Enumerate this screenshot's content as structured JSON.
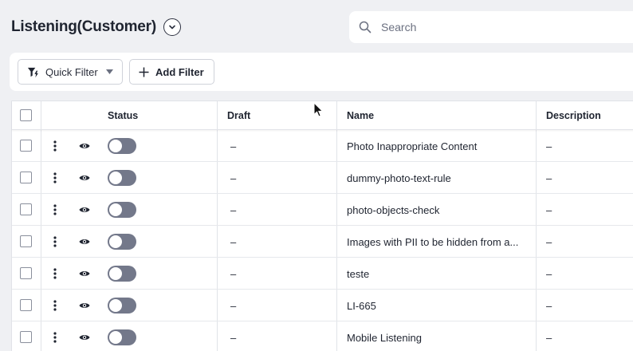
{
  "header": {
    "title": "Listening(Customer)",
    "title_dropdown_icon": "chevron-down-icon",
    "search": {
      "placeholder": "Search",
      "value": "",
      "icon": "search-icon"
    }
  },
  "filter_bar": {
    "quick_filter_label": "Quick Filter",
    "quick_filter_icon": "filter-lightning-icon",
    "add_filter_label": "Add Filter",
    "add_filter_icon": "plus-icon"
  },
  "table": {
    "columns": [
      "Status",
      "Draft",
      "Name",
      "Description"
    ],
    "rows": [
      {
        "draft": "–",
        "name": "Photo Inappropriate Content",
        "description": "–",
        "status_enabled": false
      },
      {
        "draft": "–",
        "name": "dummy-photo-text-rule",
        "description": "–",
        "status_enabled": false
      },
      {
        "draft": "–",
        "name": "photo-objects-check",
        "description": "–",
        "status_enabled": false
      },
      {
        "draft": "–",
        "name": "Images with PII to be hidden from a...",
        "description": "–",
        "status_enabled": false
      },
      {
        "draft": "–",
        "name": "teste",
        "description": "–",
        "status_enabled": false
      },
      {
        "draft": "–",
        "name": "LI-665",
        "description": "–",
        "status_enabled": false
      },
      {
        "draft": "–",
        "name": "Mobile Listening",
        "description": "–",
        "status_enabled": false
      }
    ]
  },
  "colors": {
    "page_background": "#eff0f3",
    "toggle_off": "#73788a",
    "text_primary": "#1f2430"
  }
}
